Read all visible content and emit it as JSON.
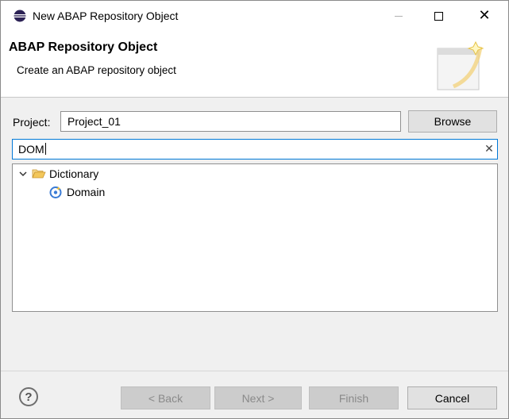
{
  "window": {
    "title": "New ABAP Repository Object",
    "controls": [
      "minimize",
      "maximize",
      "close"
    ]
  },
  "banner": {
    "title": "ABAP Repository Object",
    "description": "Create an ABAP repository object"
  },
  "project": {
    "label": "Project:",
    "value": "Project_01",
    "browse_label": "Browse"
  },
  "filter": {
    "value": "DOM"
  },
  "tree": {
    "items": [
      {
        "label": "Dictionary",
        "icon": "folder-open-icon",
        "expanded": true,
        "children": [
          {
            "label": "Domain",
            "icon": "domain-icon"
          }
        ]
      }
    ]
  },
  "buttons": {
    "help": "?",
    "back": "< Back",
    "next": "Next >",
    "finish": "Finish",
    "cancel": "Cancel"
  },
  "colors": {
    "focus_border": "#0078d7",
    "folder": "#e8b84a",
    "domain_icon": "#3a7bd5"
  }
}
